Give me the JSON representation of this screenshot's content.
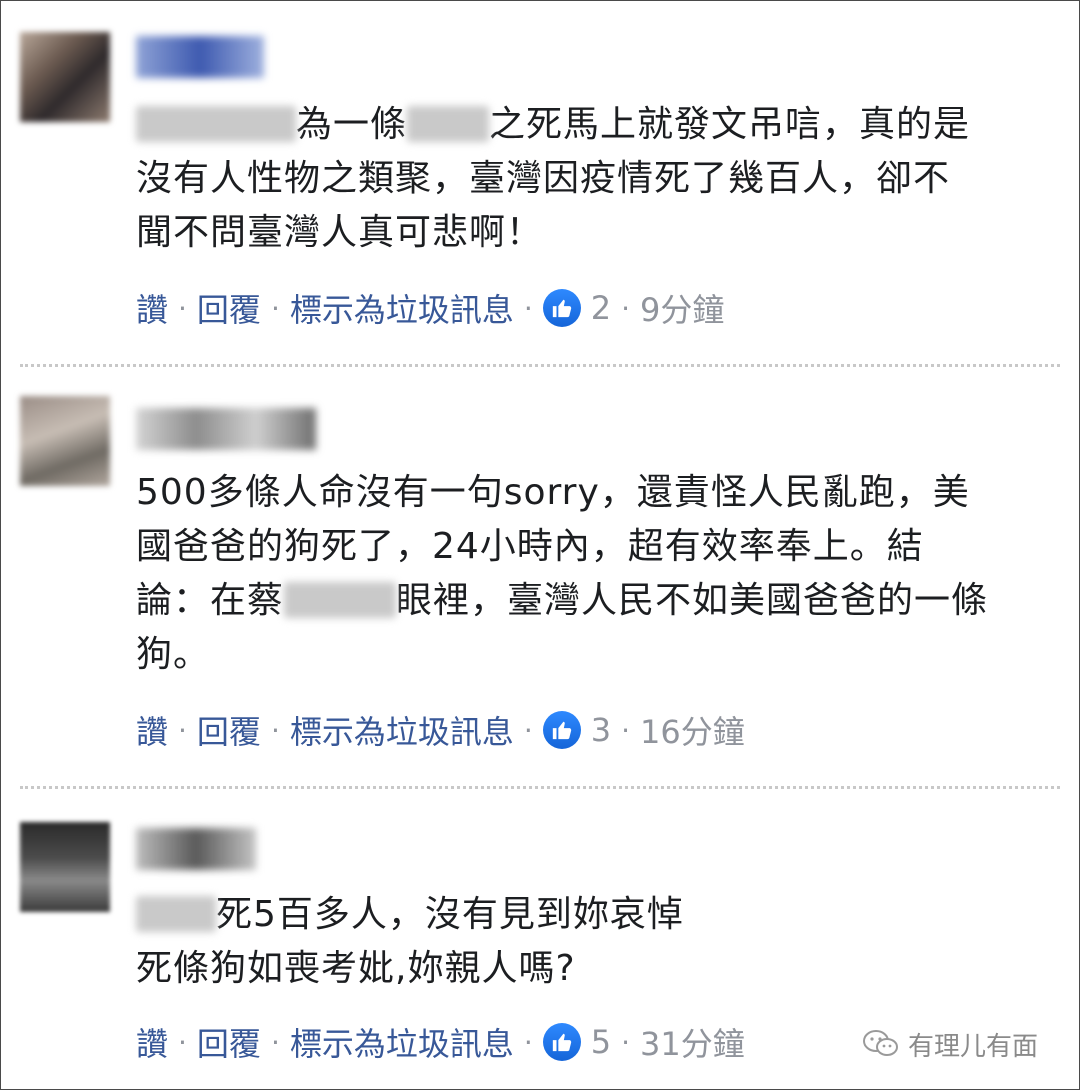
{
  "comments": [
    {
      "text_line1": "為一條",
      "text_line1b": "之死馬上就發文吊唁，真的是",
      "text_line2": "沒有人性物之類聚，臺灣因疫情死了幾百人，卻不",
      "text_line3": "聞不問臺灣人真可悲啊！",
      "like_label": "讚",
      "reply_label": "回覆",
      "spam_label": "標示為垃圾訊息",
      "like_count": "2",
      "time": "9分鐘"
    },
    {
      "text_line1": "500多條人命沒有一句sorry，還責怪人民亂跑，美",
      "text_line2": "國爸爸的狗死了，24小時內，超有效率奉上。結",
      "text_line3a": "論：在蔡",
      "text_line3b": "眼裡，臺灣人民不如美國爸爸的一條",
      "text_line4": "狗。",
      "like_label": "讚",
      "reply_label": "回覆",
      "spam_label": "標示為垃圾訊息",
      "like_count": "3",
      "time": "16分鐘"
    },
    {
      "text_line1": "死5百多人，沒有見到妳哀悼",
      "text_line2": "死條狗如喪考妣,妳親人嗎?",
      "like_label": "讚",
      "reply_label": "回覆",
      "spam_label": "標示為垃圾訊息",
      "like_count": "5",
      "time": "31分鐘"
    }
  ],
  "separator": "·",
  "watermark": {
    "text": "有理儿有面"
  },
  "icons": {
    "like": "thumbs-up-icon",
    "watermark": "wechat-icon"
  },
  "colors": {
    "link": "#385898",
    "meta": "#90949c",
    "text": "#1c1e21",
    "like_badge": "#2e89ff"
  }
}
